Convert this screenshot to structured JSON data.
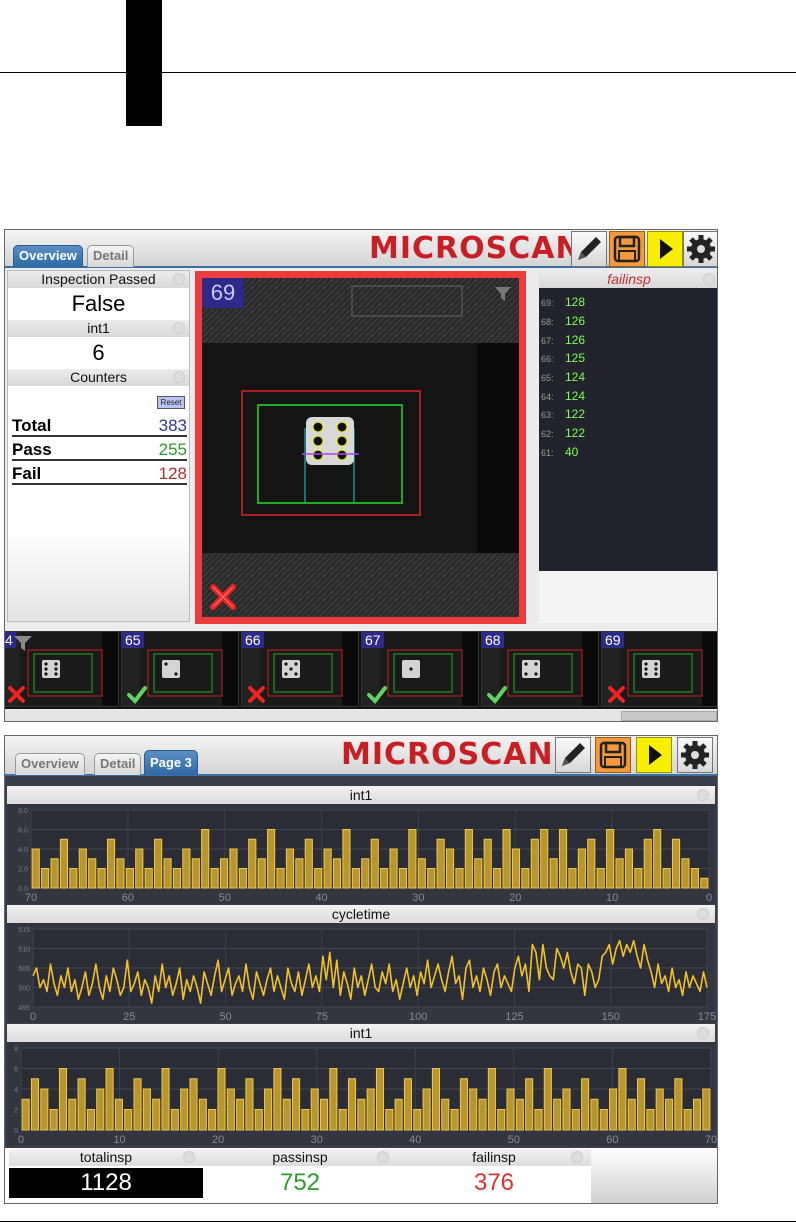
{
  "brand": {
    "logo_text": "MICROSCAN",
    "logo_color": "#c81e24"
  },
  "screen1": {
    "tabs": [
      {
        "label": "Overview",
        "active": true
      },
      {
        "label": "Detail",
        "active": false
      }
    ],
    "left_panel": {
      "inspection_passed_title": "Inspection Passed",
      "inspection_passed_value": "False",
      "int1_title": "int1",
      "int1_value": "6",
      "counters_title": "Counters",
      "reset_label": "Reset",
      "counters": [
        {
          "label": "Total",
          "value": "383",
          "color": "#333399"
        },
        {
          "label": "Pass",
          "value": "255",
          "color": "#2e9b2e"
        },
        {
          "label": "Fail",
          "value": "128",
          "color": "#b03030"
        }
      ]
    },
    "image_view": {
      "inspection_number": "69",
      "status": "fail",
      "border_color": "#ee3b3b"
    },
    "log_panel": {
      "title": "failinsp",
      "rows": [
        {
          "idx": "69:",
          "value": "128"
        },
        {
          "idx": "68:",
          "value": "126"
        },
        {
          "idx": "67:",
          "value": "126"
        },
        {
          "idx": "66:",
          "value": "125"
        },
        {
          "idx": "65:",
          "value": "124"
        },
        {
          "idx": "64:",
          "value": "124"
        },
        {
          "idx": "63:",
          "value": "122"
        },
        {
          "idx": "62:",
          "value": "122"
        },
        {
          "idx": "61:",
          "value": "40"
        }
      ]
    },
    "filmstrip": [
      {
        "num": "4",
        "status": "fail",
        "pips": 6
      },
      {
        "num": "65",
        "status": "pass",
        "pips": 2
      },
      {
        "num": "66",
        "status": "fail",
        "pips": 5
      },
      {
        "num": "67",
        "status": "pass",
        "pips": 1
      },
      {
        "num": "68",
        "status": "pass",
        "pips": 4
      },
      {
        "num": "69",
        "status": "fail",
        "pips": 6
      }
    ]
  },
  "screen2": {
    "tabs": [
      {
        "label": "Overview",
        "active": false
      },
      {
        "label": "Detail",
        "active": false
      },
      {
        "label": "Page 3",
        "active": true
      }
    ],
    "chart_data": [
      {
        "type": "bar",
        "title": "int1",
        "ylim": [
          0,
          8
        ],
        "yticks": [
          "0.0",
          "2.0",
          "4.0",
          "6.0",
          "8.0"
        ],
        "xticks": [
          "70",
          "60",
          "50",
          "40",
          "30",
          "20",
          "10",
          "0"
        ],
        "values": [
          4,
          2,
          3,
          5,
          2,
          4,
          3,
          2,
          5,
          3,
          2,
          4,
          2,
          5,
          3,
          2,
          4,
          3,
          6,
          2,
          3,
          4,
          2,
          5,
          3,
          6,
          2,
          4,
          3,
          5,
          2,
          4,
          3,
          6,
          2,
          3,
          5,
          2,
          4,
          2,
          6,
          3,
          2,
          5,
          4,
          2,
          6,
          3,
          5,
          2,
          6,
          4,
          2,
          5,
          6,
          3,
          6,
          2,
          4,
          5,
          2,
          6,
          3,
          4,
          2,
          5,
          6,
          2,
          5,
          3,
          2,
          1
        ]
      },
      {
        "type": "line",
        "title": "cycletime",
        "ylim": [
          495,
          515
        ],
        "yticks": [
          "495",
          "500",
          "505",
          "510",
          "515"
        ],
        "xticks": [
          "0",
          "25",
          "50",
          "75",
          "100",
          "125",
          "150",
          "175"
        ],
        "values": [
          503,
          505,
          500,
          502,
          499,
          506,
          501,
          498,
          503,
          500,
          505,
          499,
          502,
          497,
          500,
          504,
          498,
          501,
          506,
          500,
          497,
          503,
          499,
          505,
          502,
          498,
          500,
          507,
          499,
          501,
          504,
          498,
          502,
          500,
          496,
          503,
          499,
          506,
          500,
          503,
          498,
          501,
          505,
          497,
          502,
          499,
          503,
          500,
          496,
          504,
          501,
          498,
          503,
          507,
          499,
          502,
          505,
          498,
          501,
          503,
          499,
          506,
          500,
          497,
          504,
          501,
          498,
          502,
          505,
          499,
          503,
          500,
          497,
          505,
          501,
          499,
          504,
          498,
          502,
          506,
          500,
          503,
          499,
          508,
          502,
          509,
          500,
          507,
          498,
          504,
          501,
          497,
          505,
          500,
          503,
          498,
          502,
          506,
          500,
          499,
          504,
          501,
          506,
          499,
          502,
          497,
          501,
          505,
          500,
          503,
          498,
          504,
          501,
          507,
          500,
          503,
          506,
          502,
          499,
          504,
          508,
          501,
          503,
          497,
          505,
          507,
          500,
          503,
          499,
          505,
          502,
          498,
          504,
          506,
          500,
          503,
          501,
          499,
          505,
          508,
          503,
          506,
          499,
          511,
          509,
          502,
          511,
          505,
          503,
          502,
          510,
          508,
          505,
          509,
          504,
          501,
          506,
          505,
          498,
          506,
          504,
          500,
          502,
          508,
          509,
          511,
          506,
          510,
          512,
          508,
          511,
          509,
          512,
          508,
          505,
          511,
          507,
          504,
          500,
          506,
          501,
          503,
          499,
          505,
          500,
          502,
          498,
          504,
          500,
          503,
          501,
          499,
          504,
          500
        ]
      },
      {
        "type": "bar",
        "title": "int1",
        "ylim": [
          0,
          8
        ],
        "yticks": [
          "0",
          "2",
          "4",
          "6",
          "8"
        ],
        "xticks": [
          "0",
          "10",
          "20",
          "30",
          "40",
          "50",
          "60",
          "70"
        ],
        "values": [
          3,
          5,
          4,
          2,
          6,
          3,
          5,
          2,
          4,
          6,
          3,
          2,
          5,
          4,
          3,
          6,
          2,
          4,
          5,
          3,
          2,
          6,
          4,
          3,
          5,
          2,
          4,
          6,
          3,
          5,
          2,
          4,
          3,
          6,
          2,
          5,
          3,
          4,
          6,
          2,
          3,
          5,
          2,
          4,
          6,
          3,
          2,
          5,
          4,
          3,
          6,
          2,
          4,
          3,
          5,
          2,
          6,
          3,
          4,
          2,
          5,
          3,
          2,
          4,
          6,
          3,
          5,
          2,
          4,
          3,
          5,
          2,
          3,
          4
        ]
      }
    ],
    "totals": [
      {
        "title": "totalinsp",
        "value": "1128",
        "color": "#ffffff",
        "bg": "#000000"
      },
      {
        "title": "passinsp",
        "value": "752",
        "color": "#2e9b2e",
        "bg": "#ffffff"
      },
      {
        "title": "failinsp",
        "value": "376",
        "color": "#e03030",
        "bg": "#ffffff"
      }
    ]
  }
}
